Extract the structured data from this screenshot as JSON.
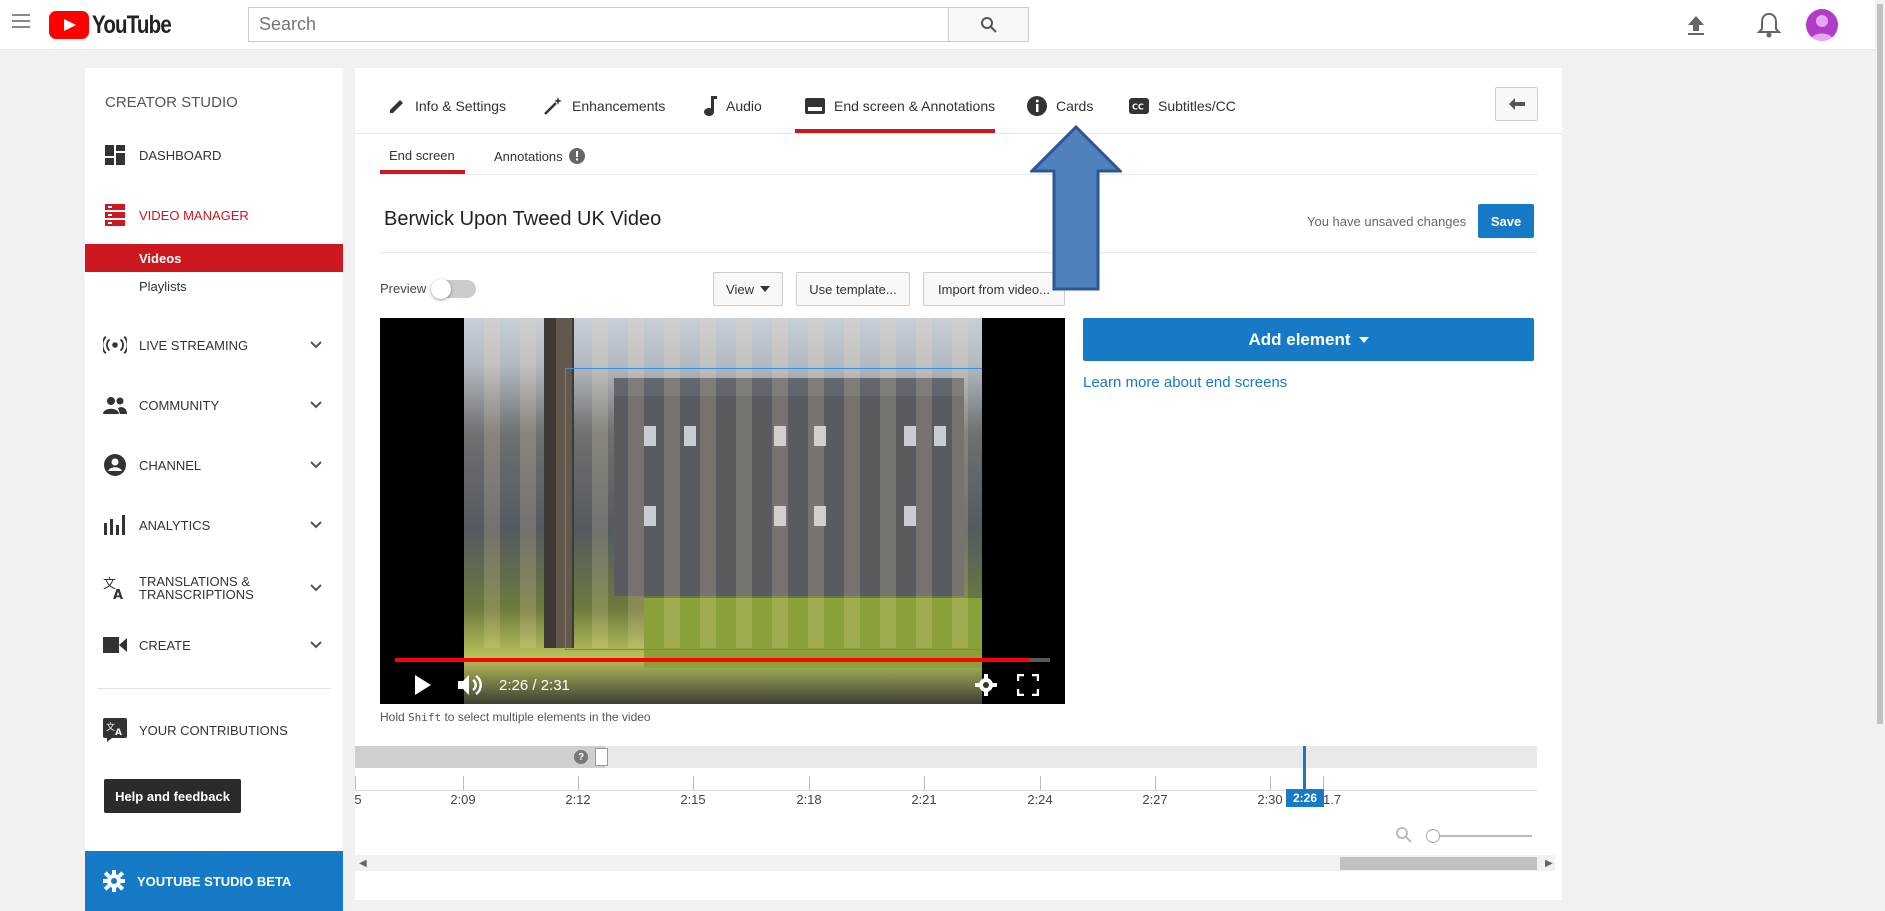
{
  "app": {
    "name": "YouTube"
  },
  "search": {
    "placeholder": "Search"
  },
  "sidebar": {
    "heading": "CREATOR STUDIO",
    "items": [
      {
        "label": "DASHBOARD",
        "icon": "dashboard-icon"
      },
      {
        "label": "VIDEO MANAGER",
        "icon": "video-manager-icon",
        "active": true
      },
      {
        "label": "LIVE STREAMING",
        "icon": "live-streaming-icon"
      },
      {
        "label": "COMMUNITY",
        "icon": "community-icon"
      },
      {
        "label": "CHANNEL",
        "icon": "channel-icon"
      },
      {
        "label": "ANALYTICS",
        "icon": "analytics-icon"
      },
      {
        "label": "TRANSLATIONS & TRANSCRIPTIONS",
        "icon": "translations-icon"
      },
      {
        "label": "CREATE",
        "icon": "create-icon"
      }
    ],
    "subitems": [
      {
        "label": "Videos",
        "active": true
      },
      {
        "label": "Playlists"
      }
    ],
    "contributions": "YOUR CONTRIBUTIONS",
    "help": "Help and feedback",
    "studio_beta": "YOUTUBE STUDIO BETA"
  },
  "tabs": [
    {
      "label": "Info & Settings",
      "icon": "pencil-icon"
    },
    {
      "label": "Enhancements",
      "icon": "magic-wand-icon"
    },
    {
      "label": "Audio",
      "icon": "music-note-icon"
    },
    {
      "label": "End screen & Annotations",
      "icon": "end-screen-icon",
      "active": true
    },
    {
      "label": "Cards",
      "icon": "info-icon"
    },
    {
      "label": "Subtitles/CC",
      "icon": "cc-icon"
    }
  ],
  "subtabs": [
    {
      "label": "End screen",
      "active": true
    },
    {
      "label": "Annotations"
    }
  ],
  "editor": {
    "video_title": "Berwick Upon Tweed UK Video",
    "unsaved_text": "You have unsaved changes",
    "save_label": "Save",
    "preview_label": "Preview",
    "preview_on": false,
    "view_label": "View",
    "template_label": "Use template...",
    "import_label": "Import from video...",
    "add_element_label": "Add element",
    "learn_more": "Learn more about end screens",
    "hold_prefix": "Hold ",
    "hold_key": "Shift",
    "hold_suffix": " to select multiple elements in the video"
  },
  "player": {
    "time": "2:26 / 2:31",
    "progress": 0.967
  },
  "timeline": {
    "labels": [
      "5",
      "2:09",
      "2:12",
      "2:15",
      "2:18",
      "2:21",
      "2:24",
      "2:27",
      "2:30",
      "2:31.7"
    ],
    "playhead": "2:26"
  },
  "colors": {
    "brand_red": "#cc181e",
    "accent_blue": "#167ac6",
    "arrow_blue": "#4f81bd"
  }
}
